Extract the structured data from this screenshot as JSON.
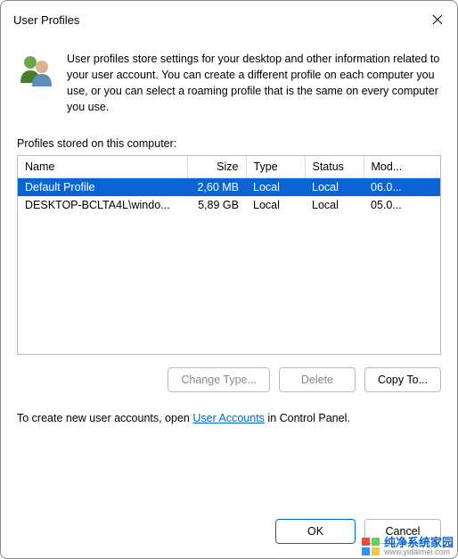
{
  "window": {
    "title": "User Profiles"
  },
  "intro": {
    "text": "User profiles store settings for your desktop and other information related to your user account. You can create a different profile on each computer you use, or you can select a roaming profile that is the same on every computer you use."
  },
  "section_label": "Profiles stored on this computer:",
  "columns": {
    "name": "Name",
    "size": "Size",
    "type": "Type",
    "status": "Status",
    "modified": "Mod..."
  },
  "rows": [
    {
      "name": "Default Profile",
      "size": "2,60 MB",
      "type": "Local",
      "status": "Local",
      "modified": "06.0...",
      "selected": true
    },
    {
      "name": "DESKTOP-BCLTA4L\\windo...",
      "size": "5,89 GB",
      "type": "Local",
      "status": "Local",
      "modified": "05.0...",
      "selected": false
    }
  ],
  "buttons": {
    "change_type": "Change Type...",
    "delete": "Delete",
    "copy_to": "Copy To..."
  },
  "help": {
    "prefix": "To create new user accounts, open ",
    "link": "User Accounts",
    "suffix": " in Control Panel."
  },
  "bottom": {
    "ok": "OK",
    "cancel": "Cancel"
  },
  "watermark": {
    "line1": "纯净系统家园",
    "line2": "www.yidaimei.com"
  }
}
